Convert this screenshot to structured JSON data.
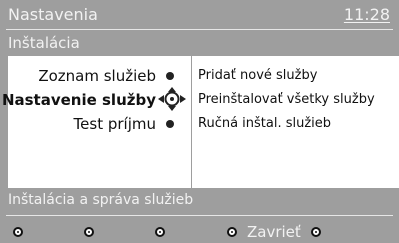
{
  "header": {
    "title": "Nastavenia",
    "time": "11:28",
    "subtitle": "Inštalácia"
  },
  "menu": {
    "items": [
      {
        "label": "Zoznam služieb"
      },
      {
        "label": "Nastavenie služby"
      },
      {
        "label": "Test príjmu"
      }
    ]
  },
  "options": {
    "items": [
      {
        "label": "Pridať nové služby"
      },
      {
        "label": "Preinštalovať všetky služby"
      },
      {
        "label": "Ručná inštal. služieb"
      }
    ]
  },
  "status": {
    "text": "Inštalácia a správa služieb"
  },
  "footer": {
    "close_label": "Zavrieť"
  },
  "colors": {
    "bar": "#9e9e9e",
    "panel": "#ffffff",
    "text_light": "#f2f2f2",
    "text_dark": "#111111"
  }
}
